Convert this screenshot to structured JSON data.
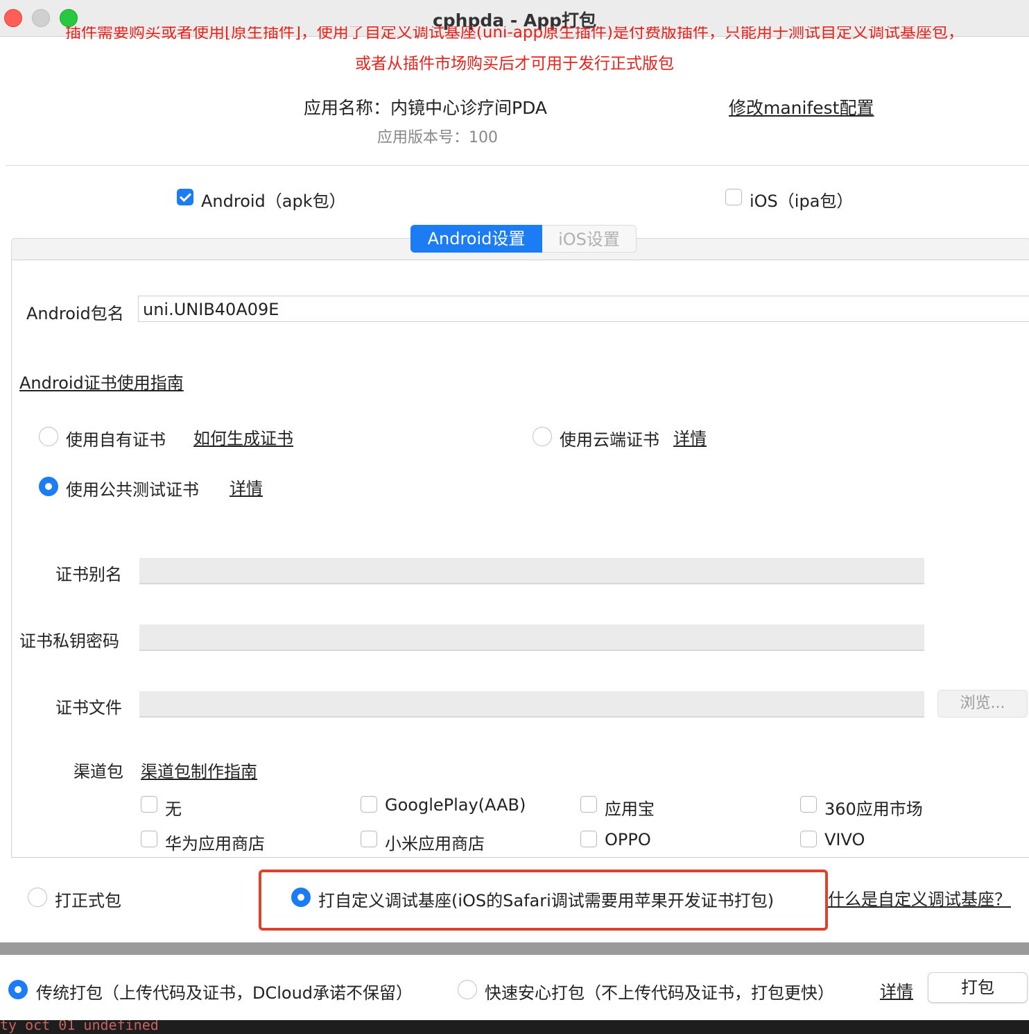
{
  "window": {
    "title": "cphpda - App打包"
  },
  "warning": {
    "line1_partial": "插件需要购买或者使用[原生插件]，使用了自定义调试基座(uni-app原生插件)是付费版插件，只能用于测试自定义调试基座包，",
    "line2": "或者从插件市场购买后才可用于发行正式版包"
  },
  "app_info": {
    "name_label": "应用名称：内镜中心诊疗间PDA",
    "version_label": "应用版本号：100",
    "manifest_link": "修改manifest配置"
  },
  "platforms": {
    "android": {
      "label": "Android（apk包）",
      "checked": true
    },
    "ios": {
      "label": "iOS（ipa包）",
      "checked": false
    }
  },
  "tabs": {
    "android": "Android设置",
    "ios": "iOS设置"
  },
  "android": {
    "package_label": "Android包名",
    "package_value": "uni.UNIB40A09E",
    "cert_guide_link": "Android证书使用指南",
    "cert_options": {
      "own": {
        "label": "使用自有证书",
        "link": "如何生成证书",
        "selected": false
      },
      "cloud": {
        "label": "使用云端证书",
        "link": "详情",
        "selected": false
      },
      "public": {
        "label": "使用公共测试证书",
        "link": "详情",
        "selected": true
      }
    },
    "alias_label": "证书别名",
    "password_label": "证书私钥密码",
    "file_label": "证书文件",
    "browse_label": "浏览...",
    "channel_label": "渠道包",
    "channel_link": "渠道包制作指南",
    "channels": [
      {
        "label": "无",
        "checked": false
      },
      {
        "label": "GooglePlay(AAB)",
        "checked": false
      },
      {
        "label": "应用宝",
        "checked": false
      },
      {
        "label": "360应用市场",
        "checked": false
      },
      {
        "label": "华为应用商店",
        "checked": false
      },
      {
        "label": "小米应用商店",
        "checked": false
      },
      {
        "label": "OPPO",
        "checked": false
      },
      {
        "label": "VIVO",
        "checked": false
      }
    ]
  },
  "build_type": {
    "release": {
      "label": "打正式包",
      "selected": false
    },
    "custom_base": {
      "label": "打自定义调试基座(iOS的Safari调试需要用苹果开发证书打包)",
      "selected": true
    },
    "help_link": "什么是自定义调试基座？"
  },
  "pack_mode": {
    "traditional": {
      "label": "传统打包（上传代码及证书，DCloud承诺不保留）",
      "selected": true
    },
    "fast": {
      "label": "快速安心打包（不上传代码及证书，打包更快）",
      "selected": false
    },
    "details_link": "详情",
    "pack_button": "打包"
  },
  "console": {
    "text": "ty  oct  01 undefined"
  },
  "colors": {
    "accent": "#1b7cf4",
    "warning": "#e8211b",
    "highlight": "#e0412a",
    "link": "#1f73d8"
  }
}
